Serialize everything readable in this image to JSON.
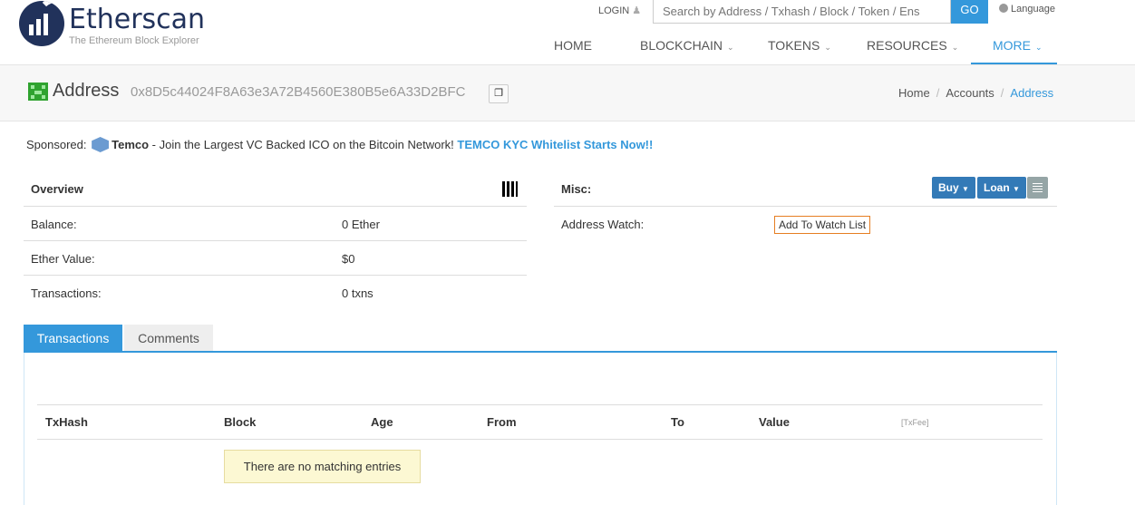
{
  "brand": {
    "name": "Etherscan",
    "tagline": "The Ethereum Block Explorer"
  },
  "header": {
    "login_label": "LOGIN",
    "search_placeholder": "Search by Address / Txhash / Block / Token / Ens",
    "go_label": "GO",
    "language_label": "Language"
  },
  "nav": [
    {
      "label": "HOME"
    },
    {
      "label": "BLOCKCHAIN"
    },
    {
      "label": "TOKENS"
    },
    {
      "label": "RESOURCES"
    },
    {
      "label": "MORE"
    }
  ],
  "page": {
    "title": "Address",
    "address": "0x8D5c44024F8A63e3A72B4560E380B5e6A33D2BFC"
  },
  "breadcrumb": [
    "Home",
    "Accounts",
    "Address"
  ],
  "sponsored": {
    "label": "Sponsored:",
    "name": "Temco",
    "text": " - Join the Largest VC Backed ICO on the Bitcoin Network! ",
    "link": "TEMCO KYC Whitelist Starts Now!!"
  },
  "overview": {
    "title": "Overview",
    "rows": [
      {
        "key": "Balance:",
        "value": "0 Ether"
      },
      {
        "key": "Ether Value:",
        "value": "$0"
      },
      {
        "key": "Transactions:",
        "value": "0 txns"
      }
    ]
  },
  "misc": {
    "title": "Misc:",
    "buy_label": "Buy",
    "loan_label": "Loan",
    "watch_key": "Address Watch:",
    "watch_button": "Add To Watch List"
  },
  "tabs": [
    {
      "label": "Transactions"
    },
    {
      "label": "Comments"
    }
  ],
  "table": {
    "columns": [
      "TxHash",
      "Block",
      "Age",
      "From",
      "To",
      "Value",
      "[TxFee]"
    ],
    "empty_message": "There are no matching entries"
  },
  "colors": {
    "accent": "#3498db",
    "brand": "#21325b",
    "watch_border": "#e67e22"
  }
}
